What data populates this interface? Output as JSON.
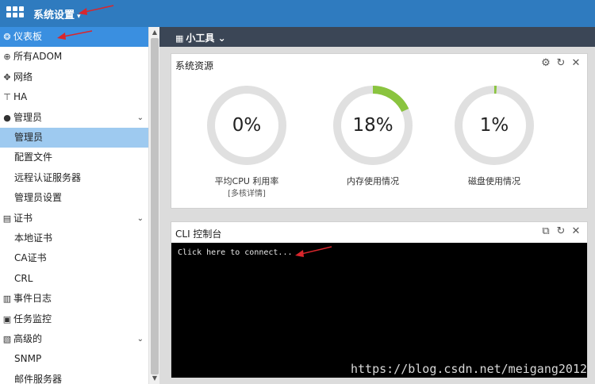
{
  "topbar": {
    "title": "系统设置"
  },
  "sidebar": {
    "items": [
      {
        "label": "仪表板",
        "icon": "dashboard-icon",
        "glyph": "❂",
        "chev": "",
        "active": true
      },
      {
        "label": "所有ADOM",
        "icon": "globe-icon",
        "glyph": "⊕",
        "chev": ""
      },
      {
        "label": "网络",
        "icon": "network-icon",
        "glyph": "✥",
        "chev": ""
      },
      {
        "label": "HA",
        "icon": "ha-icon",
        "glyph": "⊤",
        "chev": ""
      },
      {
        "label": "管理员",
        "icon": "user-icon",
        "glyph": "●",
        "chev": "⌄",
        "group": true
      },
      {
        "label": "管理员",
        "sub": true,
        "subActive": true
      },
      {
        "label": "配置文件",
        "sub": true
      },
      {
        "label": "远程认证服务器",
        "sub": true
      },
      {
        "label": "管理员设置",
        "sub": true
      },
      {
        "label": "证书",
        "icon": "certificate-icon",
        "glyph": "▤",
        "chev": "⌄",
        "group": true
      },
      {
        "label": "本地证书",
        "sub": true
      },
      {
        "label": "CA证书",
        "sub": true
      },
      {
        "label": "CRL",
        "sub": true
      },
      {
        "label": "事件日志",
        "icon": "event-log-icon",
        "glyph": "▥",
        "chev": ""
      },
      {
        "label": "任务监控",
        "icon": "task-monitor-icon",
        "glyph": "▣",
        "chev": ""
      },
      {
        "label": "高级的",
        "icon": "advanced-icon",
        "glyph": "▧",
        "chev": "⌄",
        "group": true
      },
      {
        "label": "SNMP",
        "sub": true
      },
      {
        "label": "邮件服务器",
        "sub": true
      }
    ]
  },
  "toolbar": {
    "tools_label": "小工具"
  },
  "resources": {
    "title": "系统资源",
    "gauges": [
      {
        "value": "0%",
        "fraction": 0,
        "label": "平均CPU 利用率",
        "sub": "[多核详情]"
      },
      {
        "value": "18%",
        "fraction": 0.18,
        "label": "内存使用情况",
        "sub": ""
      },
      {
        "value": "1%",
        "fraction": 0.01,
        "label": "磁盘使用情况",
        "sub": ""
      }
    ]
  },
  "cli": {
    "title": "CLI 控制台",
    "text": "Click here to connect..."
  },
  "watermark": "https://blog.csdn.net/meigang2012",
  "colors": {
    "accent": "#2f7bbf",
    "active": "#3a8fe0",
    "gauge_fill": "#8ac43f",
    "gauge_track": "#e0e0e0"
  }
}
